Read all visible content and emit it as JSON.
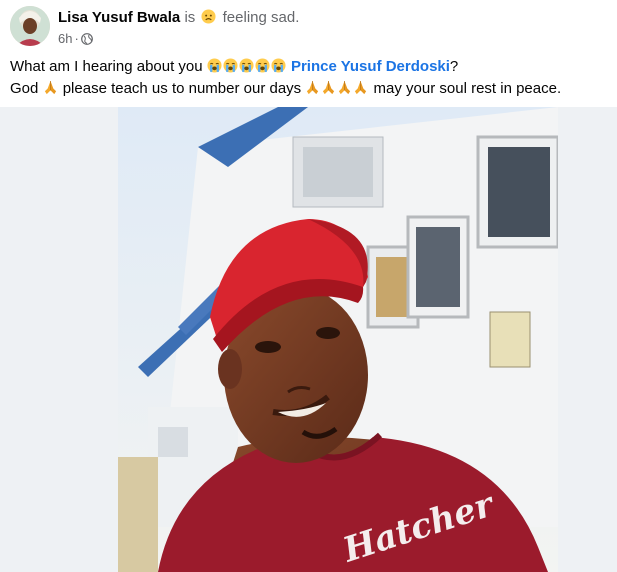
{
  "post": {
    "author": "Lisa Yusuf Bwala",
    "is_word": "is",
    "feeling_icon": "sad-face-emoji",
    "feeling": "feeling sad.",
    "time": "6h",
    "dot": "·",
    "privacy_icon": "globe-icon",
    "line1_text": "What am I hearing about you",
    "line1_emojis": [
      "loudly-crying-face",
      "loudly-crying-face",
      "loudly-crying-face",
      "loudly-crying-face",
      "loudly-crying-face"
    ],
    "mention": "Prince Yusuf Derdoski",
    "line1_end": "?",
    "line2_start": "God",
    "line2_middle": "please teach us to number our days",
    "line2_end": "may your soul rest in peace.",
    "pray_emoji": "folded-hands",
    "shirt_text": "Hatcher"
  },
  "colors": {
    "link": "#1b74e4",
    "secondary_text": "#65676b",
    "cap_red": "#d9252f",
    "shirt_maroon": "#9b1b2c"
  }
}
